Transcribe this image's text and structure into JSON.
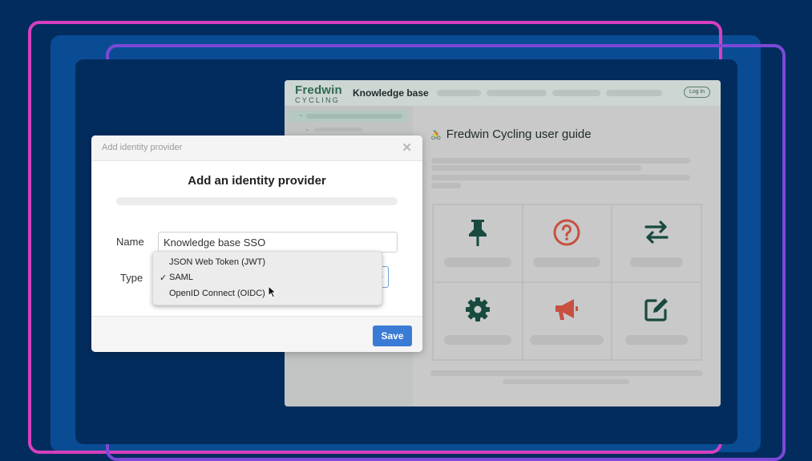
{
  "colors": {
    "background": "#032c5e",
    "frame_pink": "#d63fbe",
    "frame_purple": "#7b49d6",
    "frame_blue": "#0a4c94",
    "brand_green": "#2f6a52",
    "icon_dark": "#194a40",
    "icon_red": "#c75040",
    "save_button": "#3a7bd5"
  },
  "kb": {
    "brand_name": "Fredwin",
    "brand_sub": "CYCLING",
    "title": "Knowledge base",
    "login_label": "Log in",
    "guide_title": "Fredwin Cycling user guide",
    "guide_icon": "bicycle-icon",
    "tiles": [
      {
        "icon": "pin-icon"
      },
      {
        "icon": "question-circle-icon"
      },
      {
        "icon": "arrows-exchange-icon"
      },
      {
        "icon": "gear-icon"
      },
      {
        "icon": "megaphone-icon"
      },
      {
        "icon": "edit-icon"
      }
    ]
  },
  "dialog": {
    "header_title": "Add identity provider",
    "close_icon": "close-icon",
    "title": "Add an identity provider",
    "name_label": "Name",
    "name_value": "Knowledge base SSO",
    "type_label": "Type",
    "type_options": [
      {
        "label": "JSON Web Token (JWT)",
        "selected": false
      },
      {
        "label": "SAML",
        "selected": true
      },
      {
        "label": "OpenID Connect (OIDC)",
        "selected": false
      }
    ],
    "check_mark": "✓",
    "save_label": "Save"
  }
}
